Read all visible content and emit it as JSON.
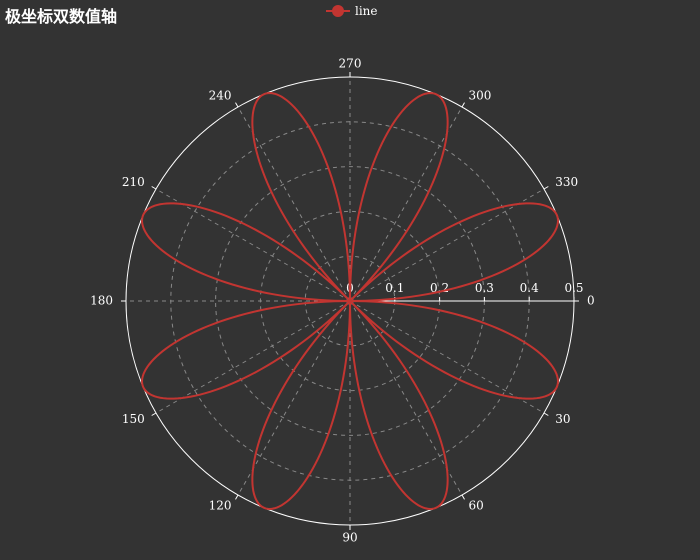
{
  "title": "极坐标双数值轴",
  "legend": {
    "items": [
      {
        "name": "line",
        "color": "#c23531"
      }
    ]
  },
  "colors": {
    "background": "#333333",
    "series": "#c23531",
    "axis": "#ffffff",
    "grid": "#888888"
  },
  "chart_data": {
    "type": "line",
    "coordinate_system": "polar",
    "title": "极坐标双数值轴",
    "angle_axis": {
      "type": "value",
      "min": 0,
      "max": 360,
      "direction": "clockwise",
      "labels": [
        "0",
        "30",
        "60",
        "90",
        "120",
        "150",
        "180",
        "210",
        "240",
        "270",
        "300",
        "330"
      ]
    },
    "radius_axis": {
      "type": "value",
      "min": 0,
      "max": 0.5,
      "labels": [
        "0",
        "0.1",
        "0.2",
        "0.3",
        "0.4",
        "0.5"
      ]
    },
    "grid": true,
    "legend_position": "top-center",
    "series": [
      {
        "name": "line",
        "formula": "r = |sin(2θ)·cos(2θ)|",
        "theta_range": [
          0,
          360
        ],
        "theta_step": 1,
        "r_max": 0.5
      }
    ]
  }
}
